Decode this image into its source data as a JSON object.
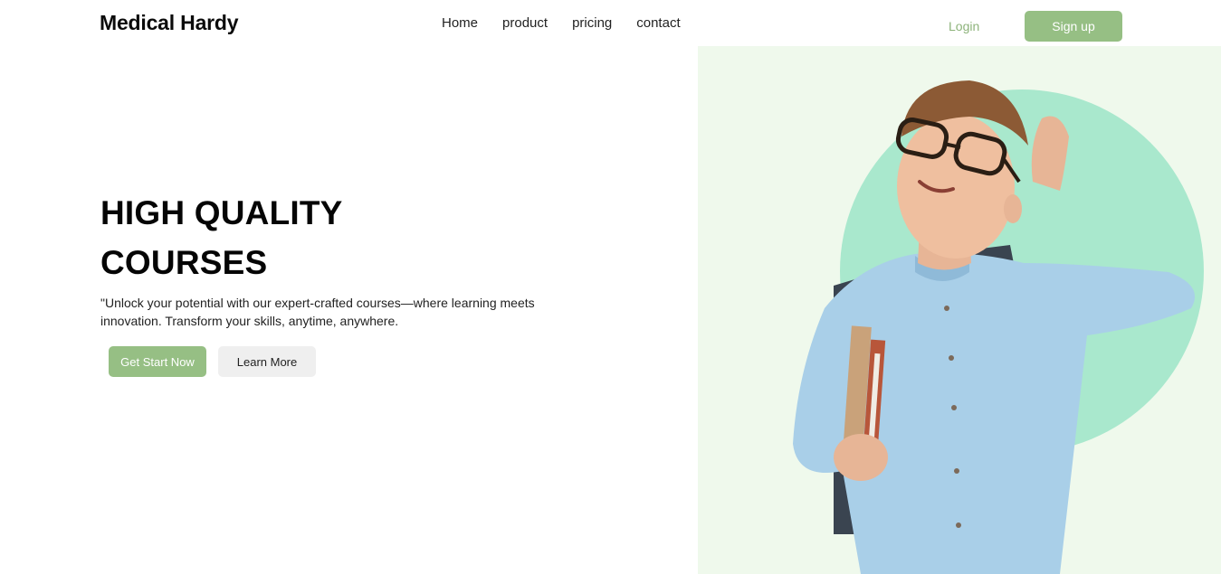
{
  "nav": {
    "logo": "Medical Hardy",
    "links": [
      "Home",
      "product",
      "pricing",
      "contact"
    ],
    "login": "Login",
    "signup": "Sign up"
  },
  "hero": {
    "headline_line1": "HIGH QUALITY",
    "headline_line2": "COURSES",
    "tagline": "\"Unlock your potential with our expert-crafted courses—where learning meets innovation. Transform your skills, anytime, anywhere.",
    "primary_button": "Get Start Now",
    "secondary_button": "Learn More"
  },
  "colors": {
    "accent_green": "#96bf84",
    "panel_bg": "#eff9ec",
    "circle": "#a9e8cd"
  }
}
